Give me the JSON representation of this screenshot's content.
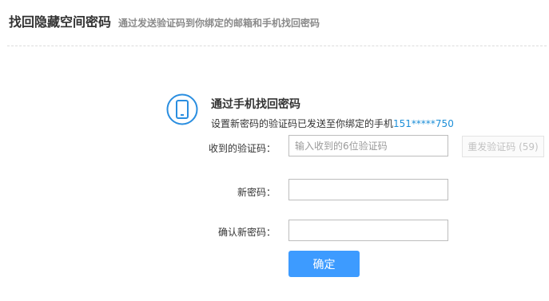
{
  "header": {
    "title": "找回隐藏空间密码",
    "subtitle": "通过发送验证码到你绑定的邮箱和手机找回密码"
  },
  "section": {
    "icon": "mobile-phone-icon",
    "title": "通过手机找回密码",
    "desc_prefix": "设置新密码的验证码已发送至你绑定的手机",
    "masked_phone": "151*****750"
  },
  "form": {
    "code_label": "收到的验证码：",
    "code_placeholder": "输入收到的6位验证码",
    "code_value": "",
    "resend_label": "重发验证码",
    "resend_countdown": "(59)",
    "new_password_label": "新密码：",
    "confirm_password_label": "确认新密码：",
    "submit_label": "确定"
  },
  "colors": {
    "accent": "#3d9bff",
    "phone_text": "#1b8ed8",
    "icon_blue": "#2a8ee0"
  }
}
